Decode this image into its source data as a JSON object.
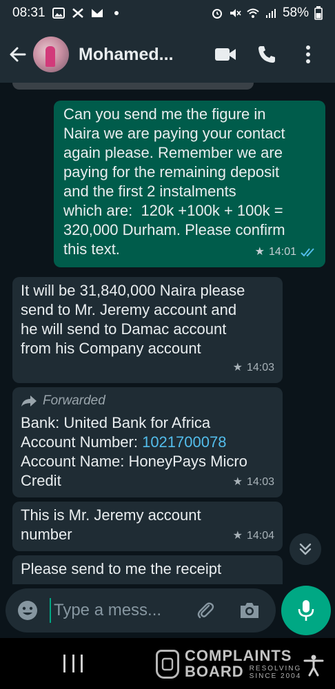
{
  "status_bar": {
    "time": "08:31",
    "battery": "58%"
  },
  "header": {
    "contact_name": "Mohamed..."
  },
  "messages": [
    {
      "direction": "outgoing",
      "text": "Can you send me the figure in\nNaira we are paying your contact\nagain please. Remember we are\npaying for the remaining deposit\nand the first 2 instalments\nwhich are:  120k +100k + 100k =\n320,000 Durham. Please confirm\nthis text.",
      "time": "14:01"
    },
    {
      "direction": "incoming",
      "text": "It will be 31,840,000 Naira please\nsend to Mr. Jeremy account and\nhe will send to Damac account\nfrom his Company account",
      "time": "14:03"
    },
    {
      "direction": "incoming",
      "forwarded_label": "Forwarded",
      "bank_line": "Bank: United Bank for Africa",
      "account_number_label": "Account Number: ",
      "account_number": "1021700078",
      "account_name_line": "Account Name: HoneyPays Micro\nCredit",
      "time": "14:03"
    },
    {
      "direction": "incoming",
      "text": "This is Mr. Jeremy account\nnumber",
      "time": "14:04"
    },
    {
      "direction": "incoming",
      "text": "Please send to me the receipt"
    }
  ],
  "composer": {
    "placeholder": "Type a mess..."
  },
  "watermark": {
    "line1": "COMPLAINTS",
    "line2": "BOARD",
    "tag1": "RESOLVING",
    "tag2": "SINCE 2004"
  },
  "colors": {
    "outgoing_bubble": "#005c4b",
    "incoming_bubble": "#1f2c34",
    "accent": "#00a884",
    "link": "#53bdeb",
    "read_ticks": "#53bdeb"
  }
}
